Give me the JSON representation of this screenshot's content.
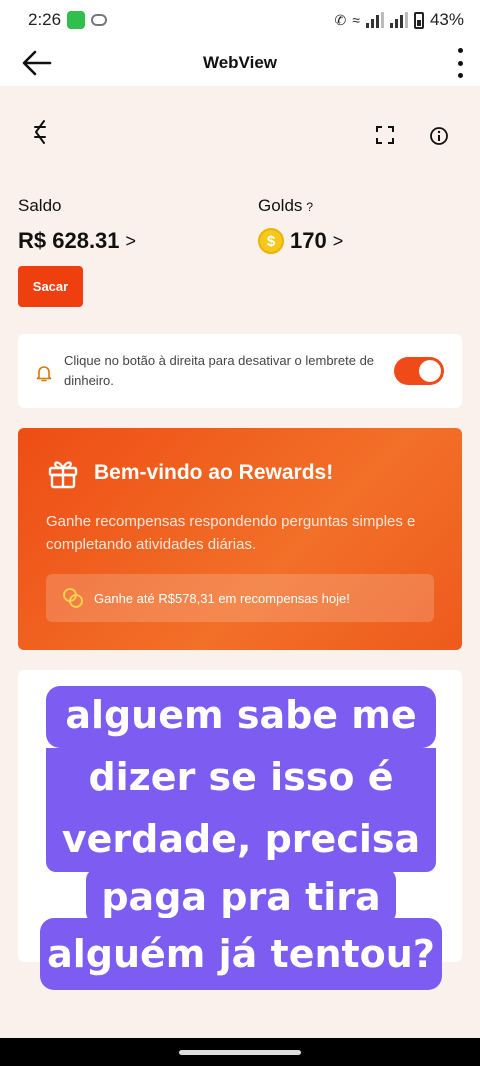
{
  "status_bar": {
    "time": "2:26",
    "battery": "43%"
  },
  "app_bar": {
    "title": "WebView"
  },
  "wallet": {
    "balance_label": "Saldo",
    "balance_value": "R$ 628.31",
    "golds_label": "Golds",
    "golds_help": "?",
    "golds_value": "170",
    "arrow": ">",
    "cashout_label": "Sacar",
    "coin_symbol": "$"
  },
  "reminder": {
    "text": "Clique no botão à direita para desativar o lembrete de dinheiro.",
    "toggle_on": true
  },
  "rewards": {
    "title": "Bem-vindo ao Rewards!",
    "description": "Ganhe recompensas respondendo perguntas simples e completando atividades diárias.",
    "earn_text": "Ganhe até R$578,31 em recompensas hoje!"
  },
  "overlay_caption": {
    "lines": [
      "alguem sabe me",
      "dizer se isso é",
      "verdade, precisa",
      "paga pra tira",
      "alguém já tentou?"
    ]
  },
  "colors": {
    "accent": "#ef3f0e",
    "caption_bg": "#7c5cf1",
    "page_bg": "#fbf1ec"
  }
}
